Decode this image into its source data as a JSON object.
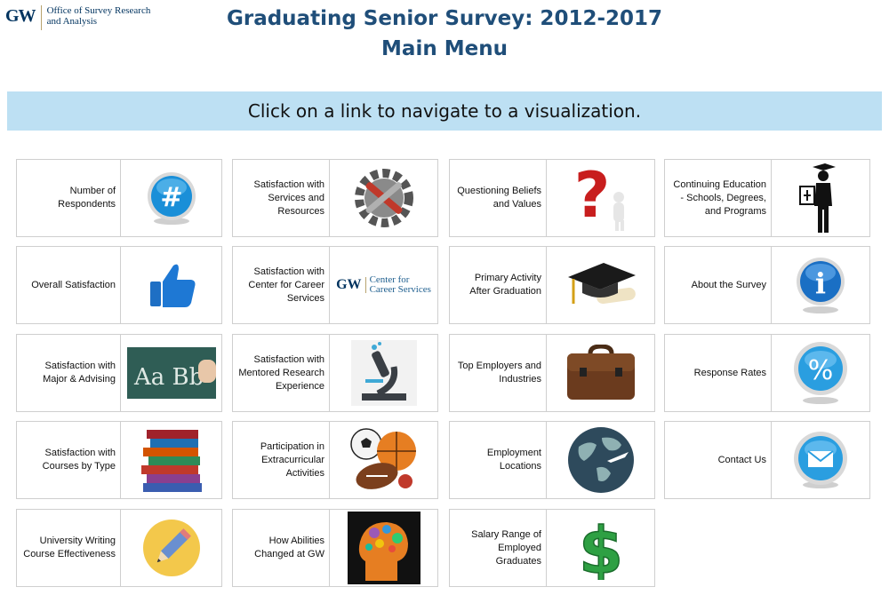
{
  "logo": {
    "mark": "GW",
    "text": "Office of Survey Research and Analysis"
  },
  "header": {
    "title": "Graduating Senior Survey: 2012-2017",
    "subtitle": "Main Menu"
  },
  "banner": {
    "text": "Click on a link to navigate to a visualization."
  },
  "ccs_logo": {
    "mark": "GW",
    "line1": "Center for",
    "line2": "Career Services"
  },
  "tiles": {
    "respondents": {
      "label": "Number of Respondents",
      "icon": "hash-icon"
    },
    "overall": {
      "label": "Overall Satisfaction",
      "icon": "thumbs-up-icon"
    },
    "major": {
      "label": "Satisfaction with Major & Advising",
      "icon": "chalkboard-icon"
    },
    "courses": {
      "label": "Satisfaction with Courses by Type",
      "icon": "books-icon"
    },
    "writing": {
      "label": "University Writing Course Effectiveness",
      "icon": "pencil-icon"
    },
    "services": {
      "label": "Satisfaction with Services and Resources",
      "icon": "tools-gear-icon"
    },
    "career": {
      "label": "Satisfaction with Center for Career Services",
      "icon": "career-services-logo"
    },
    "research": {
      "label": "Satisfaction with Mentored Research Experience",
      "icon": "microscope-icon"
    },
    "extracurricular": {
      "label": "Participation in Extracurricular Activities",
      "icon": "sports-balls-icon"
    },
    "abilities": {
      "label": "How Abilities Changed at GW",
      "icon": "brain-icon"
    },
    "beliefs": {
      "label": "Questioning Beliefs and Values",
      "icon": "question-mark-icon"
    },
    "activity": {
      "label": "Primary Activity After Graduation",
      "icon": "graduation-cap-icon"
    },
    "employers": {
      "label": "Top Employers and Industries",
      "icon": "briefcase-icon"
    },
    "locations": {
      "label": "Employment Locations",
      "icon": "globe-airplane-icon"
    },
    "salary": {
      "label": "Salary Range of Employed Graduates",
      "icon": "dollar-sign-icon"
    },
    "continuing": {
      "label": "Continuing Education - Schools, Degrees, and Programs",
      "icon": "graduate-figure-icon"
    },
    "about": {
      "label": "About the Survey",
      "icon": "info-icon"
    },
    "rates": {
      "label": "Response Rates",
      "icon": "percent-icon"
    },
    "contact": {
      "label": "Contact Us",
      "icon": "envelope-icon"
    }
  },
  "colors": {
    "title": "#1f4e79",
    "banner": "#bde0f3",
    "icon_blue": "#1a8fd8"
  }
}
